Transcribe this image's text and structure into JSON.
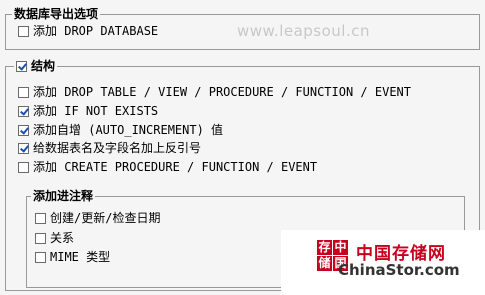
{
  "db_export_options": {
    "title": "数据库导出选项",
    "add_drop_database": {
      "label": "添加 DROP DATABASE",
      "checked": false
    }
  },
  "structure": {
    "title": "结构",
    "checked": true,
    "options": [
      {
        "label": "添加 DROP TABLE / VIEW / PROCEDURE / FUNCTION / EVENT",
        "checked": false
      },
      {
        "label": "添加 IF NOT EXISTS",
        "checked": true
      },
      {
        "label": "添加自增 (AUTO_INCREMENT) 值",
        "checked": true
      },
      {
        "label": "给数据表名及字段名加上反引号",
        "checked": true
      },
      {
        "label": "添加 CREATE PROCEDURE / FUNCTION / EVENT",
        "checked": false
      }
    ],
    "comments": {
      "title": "添加进注释",
      "options": [
        {
          "label": "创建/更新/检查日期",
          "checked": false
        },
        {
          "label": "关系",
          "checked": false
        },
        {
          "label": "MIME 类型",
          "checked": false
        }
      ]
    }
  },
  "watermark": "www.leapsoul.cn",
  "logo": {
    "chars": [
      "存",
      "储",
      "中",
      "国"
    ],
    "cn": "中国存储网",
    "en": "ChinaStor.com"
  }
}
